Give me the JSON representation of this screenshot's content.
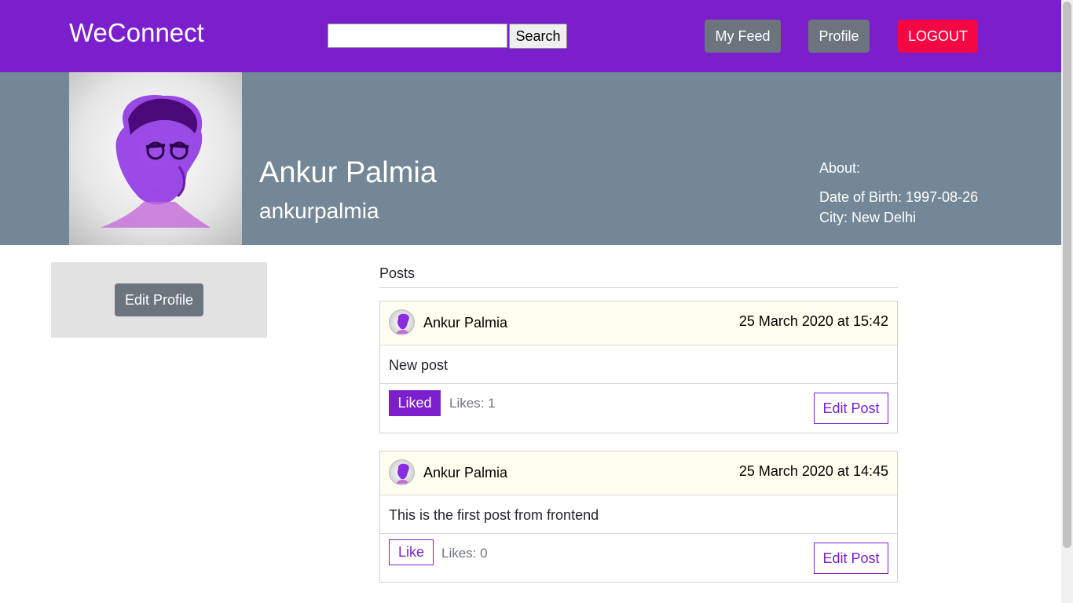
{
  "navbar": {
    "brand": "WeConnect",
    "search_placeholder": "",
    "search_button": "Search",
    "myfeed_button": "My Feed",
    "profile_button": "Profile",
    "logout_button": "LOGOUT",
    "background_color": "#7b1fcc",
    "logout_color": "#f50744"
  },
  "profile": {
    "name": "Ankur Palmia",
    "username": "ankurpalmia",
    "about_label": "About:",
    "dob": "Date of Birth: 1997-08-26",
    "city": "City: New Delhi",
    "header_color": "#748796",
    "avatar_icon": "user-portrait-icon"
  },
  "side_panel": {
    "edit_profile_button": "Edit Profile"
  },
  "posts_section": {
    "heading": "Posts",
    "posts": [
      {
        "author": "Ankur Palmia",
        "date": "25 March 2020 at 15:42",
        "content": "New post",
        "like_button": "Liked",
        "liked": true,
        "likes": "Likes: 1",
        "edit_button": "Edit Post"
      },
      {
        "author": "Ankur Palmia",
        "date": "25 March 2020 at 14:45",
        "content": "This is the first post from frontend",
        "like_button": "Like",
        "liked": false,
        "likes": "Likes: 0",
        "edit_button": "Edit Post"
      }
    ]
  }
}
